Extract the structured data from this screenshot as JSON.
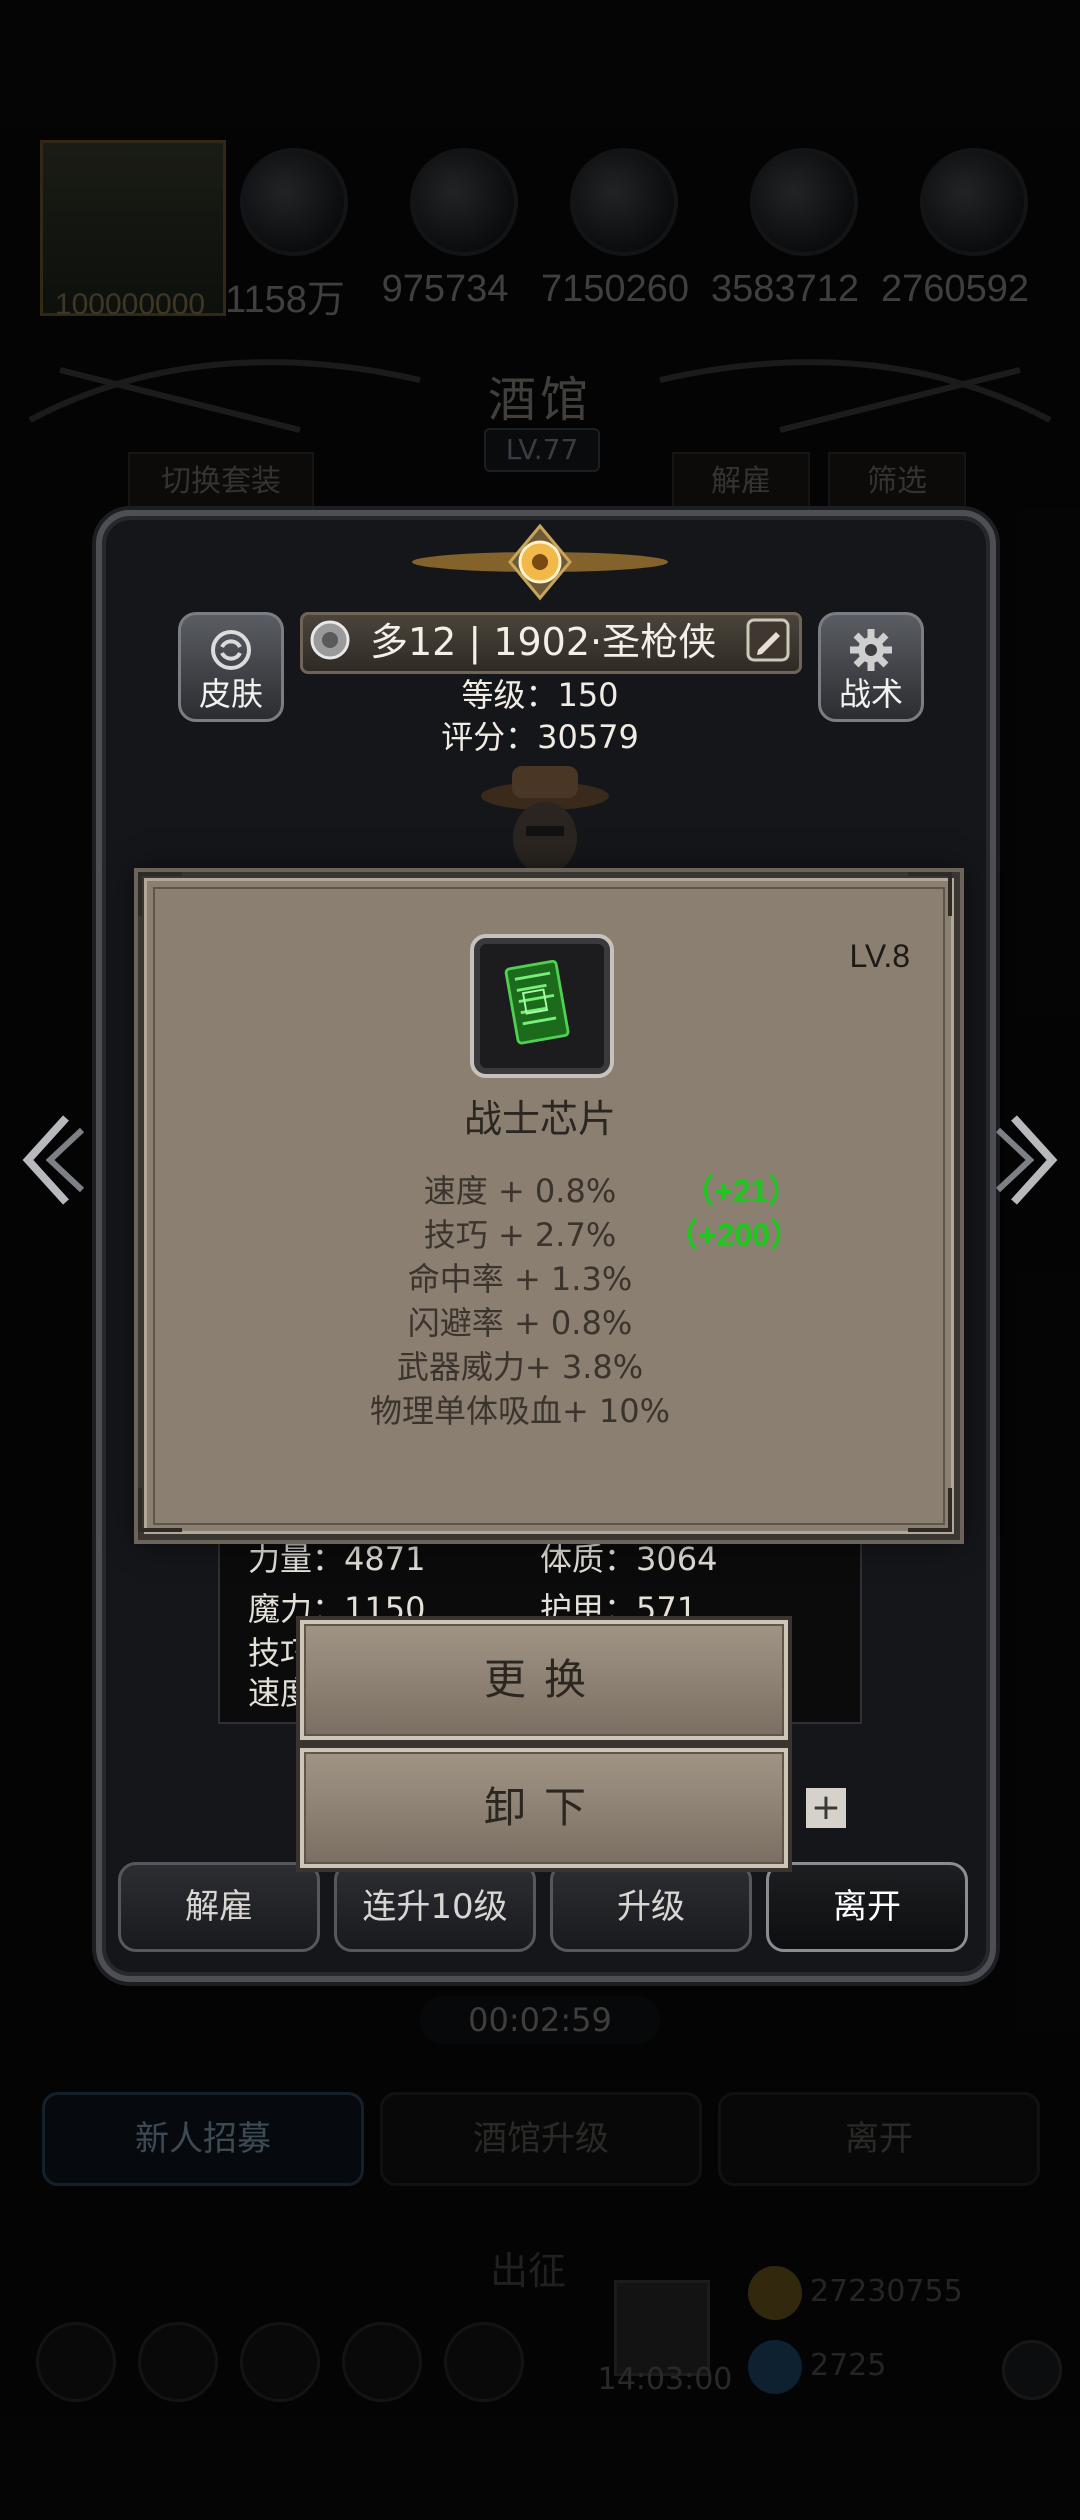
{
  "top_resources": {
    "hero_power": "100000000",
    "values": [
      "1158万",
      "975734",
      "7150260",
      "3583712",
      "2760592"
    ]
  },
  "tavern": {
    "title": "酒馆",
    "level": "LV.77",
    "switch_outfit": "切换套装",
    "dismiss": "解雇",
    "filter": "筛选"
  },
  "hero": {
    "skin_label": "皮肤",
    "tactics_label": "战术",
    "name": "多12 | 1902·圣枪侠",
    "level_line": "等级：150",
    "score_line": "评分：30579"
  },
  "stats": {
    "strength": "力量：4871",
    "constitution": "体质：3064",
    "magic": "魔力：1150",
    "armor": "护甲：571",
    "skill_partial": "技巧",
    "speed_partial": "速度"
  },
  "modal": {
    "level": "LV.8",
    "item_name": "战士芯片",
    "attributes": [
      "速度 + 0.8%",
      "技巧 + 2.7%",
      "命中率 + 1.3%",
      "闪避率 + 0.8%",
      "武器威力+ 3.8%",
      "物理单体吸血+ 10%"
    ],
    "bonus_speed": "（+21）",
    "bonus_skill": "（+200）",
    "replace_label": "更换",
    "unequip_label": "卸下"
  },
  "panel_buttons": [
    "解雇",
    "连升10级",
    "升级",
    "离开"
  ],
  "timer": "00:02:59",
  "recruit_buttons": [
    "新人招募",
    "酒馆升级",
    "离开"
  ],
  "deploy_label": "出征",
  "gift_time": "14:03:00",
  "gold": "27230755",
  "diamonds": "2725",
  "colors": {
    "bonus_green": "#1ec81e",
    "modal_parchment": "#8a7f71",
    "gold_glow": "#e0a23a"
  }
}
